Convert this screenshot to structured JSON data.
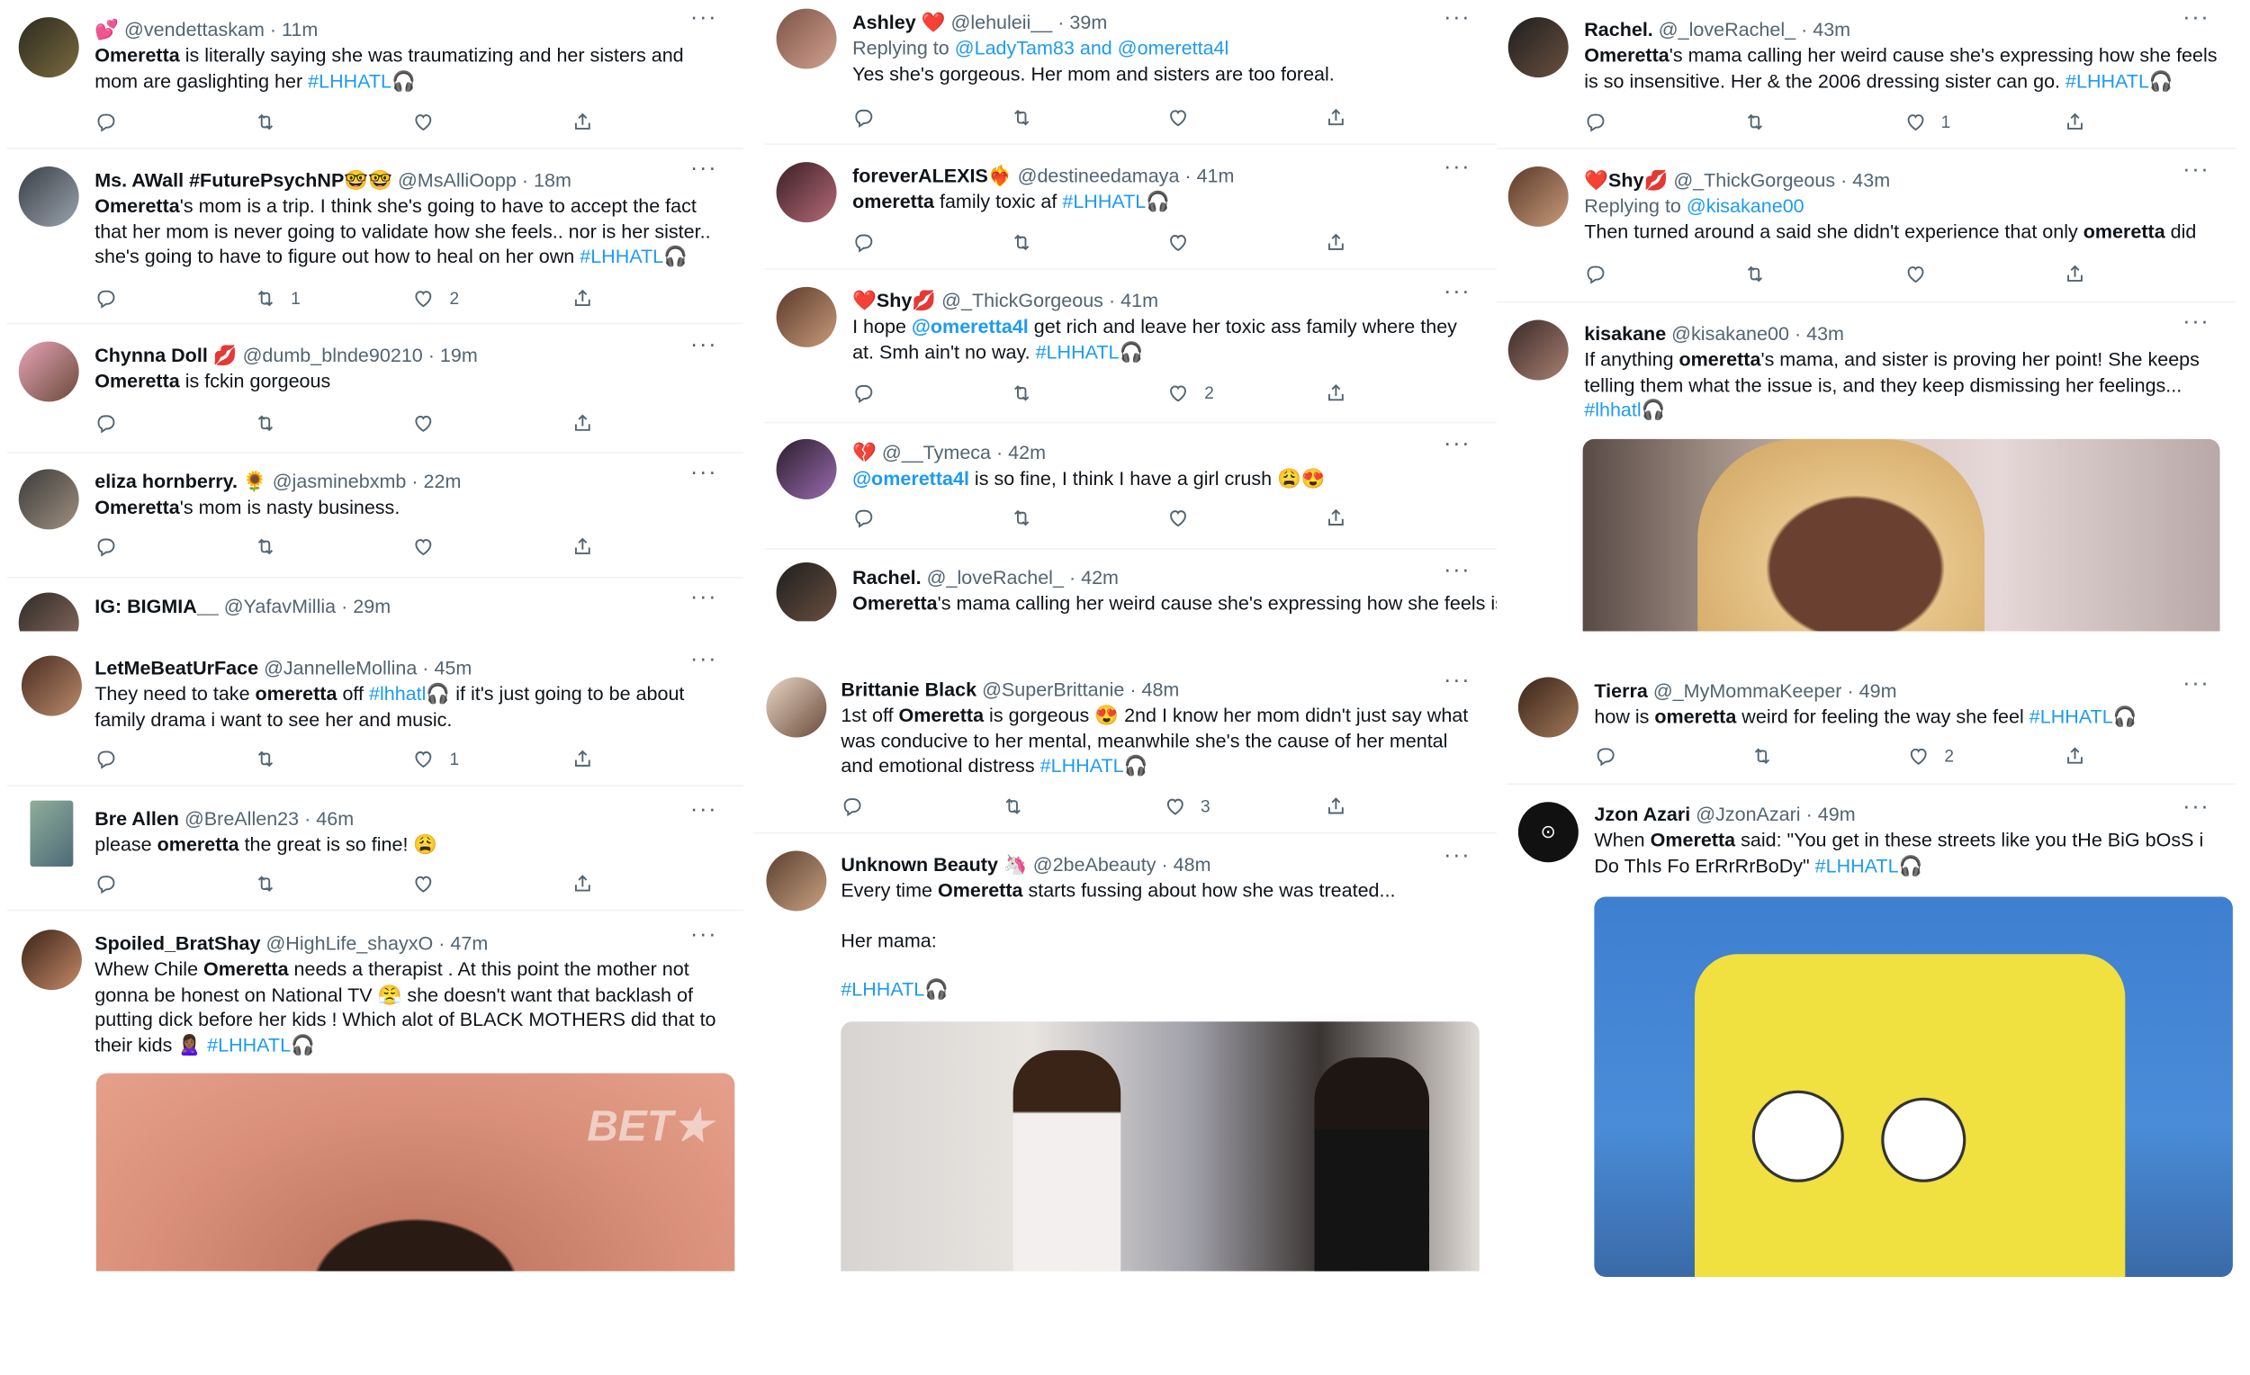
{
  "tweets": [
    {
      "name": "",
      "emoji": "💕",
      "handle": "@vendettaskam",
      "time": "· 11m",
      "reply_to": "",
      "t1": "Omeretta",
      "t2": " is literally saying she was traumatizing and her sisters and mom are gaslighting her ",
      "tag": "#LHHATL🎧",
      "reply": "",
      "retweet": "",
      "like": ""
    },
    {
      "name": "Ms. AWall #FuturePsychNP🤓🤓",
      "handle": "@MsAlliOopp",
      "time": "· 18m",
      "t1": "Omeretta",
      "t2": "'s mom is a trip. I think she's going to have to accept the fact that her mom is never going to validate how she feels.. nor is her sister.. she's going to have to figure out how to heal on her own ",
      "tag": "#LHHATL🎧",
      "retweet": "1",
      "like": "2"
    },
    {
      "name": "Chynna Doll 💋",
      "handle": "@dumb_blnde90210",
      "time": "· 19m",
      "t1": "Omeretta",
      "t2": " is fckin gorgeous",
      "tag": "",
      "retweet": "",
      "like": ""
    },
    {
      "name": "eliza hornberry. 🌻",
      "handle": "@jasminebxmb",
      "time": "· 22m",
      "t1": "Omeretta",
      "t2": "'s mom is nasty business.",
      "tag": "",
      "retweet": "",
      "like": ""
    },
    {
      "name": "IG: BIGMIA__",
      "handle": "@YafavMillia",
      "time": "· 29m"
    },
    {
      "name": "LetMeBeatUrFace",
      "handle": "@JannelleMollina",
      "time": "· 45m",
      "t0": "They need to take ",
      "t1": "omeretta",
      "t2": " off ",
      "tag_mid": "#lhhatl🎧",
      "t3": " if it's just going to be about family drama i want to see her and music.",
      "retweet": "",
      "like": "1"
    },
    {
      "name": "Bre Allen",
      "handle": "@BreAllen23",
      "time": "· 46m",
      "t0": "please ",
      "t1": "omeretta",
      "t2": " the great is so fine! 😩",
      "retweet": "",
      "like": ""
    },
    {
      "name": "Spoiled_BratShay",
      "handle": "@HighLife_shayxO",
      "time": "· 47m",
      "t0": "Whew Chile ",
      "t1": "Omeretta",
      "t2": " needs a therapist . At this point the mother not gonna be honest on National TV 😤 she doesn't want that backlash of putting dick before her kids ! Which alot of BLACK MOTHERS did that to their kids 🙎🏾‍♀️ ",
      "tag": "#LHHATL🎧",
      "media_label": "BET★"
    },
    {
      "name": "Ashley ❤️",
      "handle": "@lehuleii__",
      "time": "· 39m",
      "reply_prefix": "Replying to ",
      "reply_to": "@LadyTam83 and @omeretta4l",
      "text": "Yes she's gorgeous. Her mom and sisters are too foreal."
    },
    {
      "name": "foreverALEXIS❤️‍🔥",
      "handle": "@destineedamaya",
      "time": "· 41m",
      "t1": "omeretta",
      "t2": " family toxic af ",
      "tag": "#LHHATL🎧"
    },
    {
      "name": "❤️Shy💋",
      "handle": "@_ThickGorgeous",
      "time": "· 41m",
      "t0": "I hope ",
      "t1": "@omeretta4l",
      "t2": " get rich and leave her toxic ass family where they at. Smh ain't no way.  ",
      "tag": "#LHHATL🎧",
      "like": "2"
    },
    {
      "name": "💔",
      "handle": "@__Tymeca",
      "time": "· 42m",
      "t1": "@omeretta4l",
      "t2": " is so fine, I think I have a girl crush 😩😍"
    },
    {
      "name": "Rachel.",
      "handle": "@_loveRachel_",
      "time": "· 42m",
      "t1": "Omeretta",
      "t2": "'s mama calling her weird cause she's expressing how she feels is"
    },
    {
      "name": "Brittanie Black",
      "handle": "@SuperBrittanie",
      "time": "· 48m",
      "t0": "1st off ",
      "t1": "Omeretta",
      "t2": " is gorgeous 😍 2nd I know her mom didn't just say what was conducive to her mental, meanwhile she's the cause of her mental and emotional distress ",
      "tag": "#LHHATL🎧",
      "like": "3"
    },
    {
      "name": "Unknown Beauty 🦄",
      "handle": "@2beAbeauty",
      "time": "· 48m",
      "t0": "Every time ",
      "t1": "Omeretta",
      "t2": " starts fussing about how she was treated...",
      "line2": "Her mama:",
      "tag": "#LHHATL🎧"
    },
    {
      "name": "Rachel.",
      "handle": "@_loveRachel_",
      "time": "· 43m",
      "t1": "Omeretta",
      "t2": "'s mama calling her weird cause she's expressing how she feels is so insensitive. Her & the 2006 dressing sister can go. ",
      "tag": "#LHHATL🎧",
      "like": "1"
    },
    {
      "name": "❤️Shy💋",
      "handle": "@_ThickGorgeous",
      "time": "· 43m",
      "reply_prefix": "Replying to ",
      "reply_to": "@kisakane00",
      "t0": "Then turned around a said she didn't experience that only ",
      "t1": "omeretta",
      "t2": " did"
    },
    {
      "name": "kisakane",
      "handle": "@kisakane00",
      "time": "· 43m",
      "t0": "If anything ",
      "t1": "omeretta",
      "t2": "'s mama, and sister is proving her point! She keeps telling them what the issue is, and they keep dismissing her feelings... ",
      "tag": "#lhhatl🎧"
    },
    {
      "name": "Tierra",
      "handle": "@_MyMommaKeeper",
      "time": "· 49m",
      "t0": "how is ",
      "t1": "omeretta",
      "t2": " weird for feeling the way she feel  ",
      "tag": "#LHHATL🎧",
      "like": "2"
    },
    {
      "name": "Jzon Azari",
      "handle": "@JzonAzari",
      "time": "· 49m",
      "t0": "When ",
      "t1": "Omeretta",
      "t2": " said: \"You get in these streets like you tHe BiG bOsS i Do ThIs Fo ErRrRrBoDy\" ",
      "tag": "#LHHATL🎧"
    }
  ],
  "icons": {
    "more": "more-icon",
    "reply": "reply-icon",
    "retweet": "retweet-icon",
    "like": "like-icon",
    "share": "share-icon"
  },
  "colors": {
    "link": "#1d9bf0",
    "text": "#0f1419",
    "secondary": "#536471"
  }
}
